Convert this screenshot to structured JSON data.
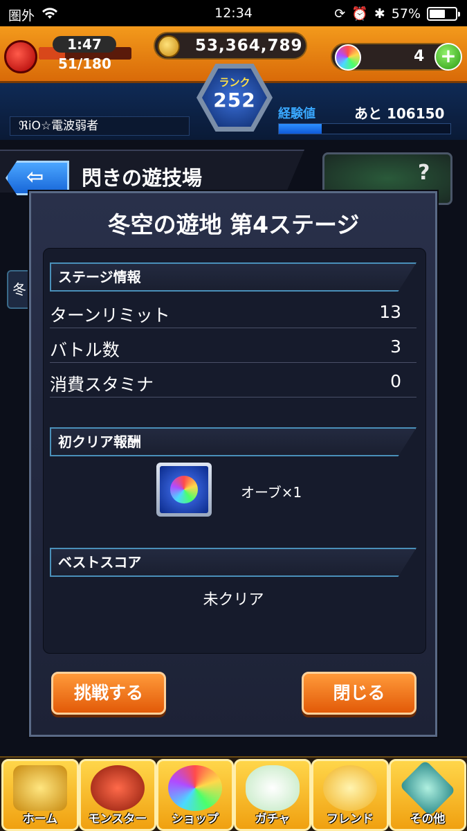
{
  "status_bar": {
    "carrier": "圏外",
    "time": "12:34",
    "battery": "57%"
  },
  "header": {
    "stamina_timer": "1:47",
    "stamina_value": "51/180",
    "stamina_fraction": 0.28,
    "gold": "53,364,789",
    "orbs": "4",
    "rank_label": "ランク",
    "rank": "252",
    "exp_label": "経験値",
    "exp_remaining": "あと 106150",
    "exp_fraction": 0.25,
    "username": "ℜiO☆電波弱者"
  },
  "section": {
    "title": "閃きの遊技場",
    "side_tab": "冬"
  },
  "modal": {
    "title": "冬空の遊地 第4ステージ",
    "stage_info_header": "ステージ情報",
    "rows": [
      {
        "label": "ターンリミット",
        "value": "13"
      },
      {
        "label": "バトル数",
        "value": "3"
      },
      {
        "label": "消費スタミナ",
        "value": "0"
      }
    ],
    "reward_header": "初クリア報酬",
    "reward_text": "オーブ×1",
    "best_header": "ベストスコア",
    "best_value": "未クリア",
    "challenge_button": "挑戦する",
    "close_button": "閉じる"
  },
  "nav": [
    {
      "label": "ホーム",
      "icon": "home-icon"
    },
    {
      "label": "モンスター",
      "icon": "monster-icon"
    },
    {
      "label": "ショップ",
      "icon": "shop-orb-icon"
    },
    {
      "label": "ガチャ",
      "icon": "gacha-egg-icon"
    },
    {
      "label": "フレンド",
      "icon": "friend-icon"
    },
    {
      "label": "その他",
      "icon": "other-icon"
    }
  ],
  "colors": {
    "accent": "#f39a1c",
    "panel": "#1d2236",
    "button": "#e25a08"
  }
}
